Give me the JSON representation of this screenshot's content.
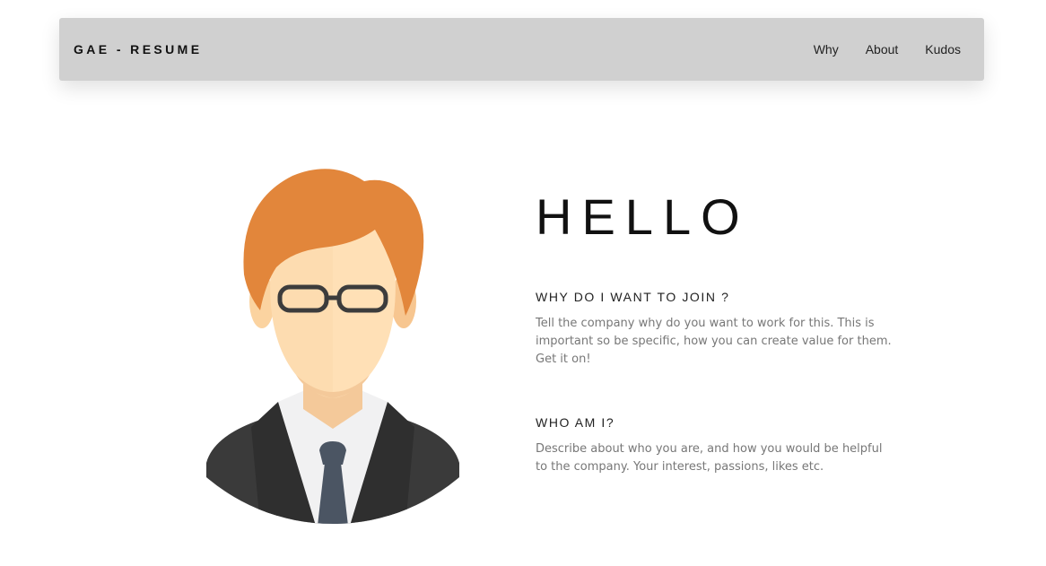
{
  "navbar": {
    "brand": "GAE - RESUME",
    "links": [
      "Why",
      "About",
      "Kudos"
    ]
  },
  "hero": {
    "greeting": "HELLO",
    "why_title": "WHY DO I WANT TO JOIN ?",
    "why_text": "Tell the company why do you want to work for this. This is important so be specific, how you can create value for them. Get it on!",
    "who_title": "WHO AM I?",
    "who_text": "Describe about who you are, and how you would be helpful to the company. Your interest, passions, likes etc."
  },
  "colors": {
    "navbar_bg": "#d0d0d0",
    "hair": "#e2863b",
    "skin": "#fddcb0",
    "suit": "#3a3a3a",
    "tie": "#4b5563",
    "text_muted": "#777777"
  },
  "icons": {
    "avatar": "businessman-avatar-illustration"
  }
}
